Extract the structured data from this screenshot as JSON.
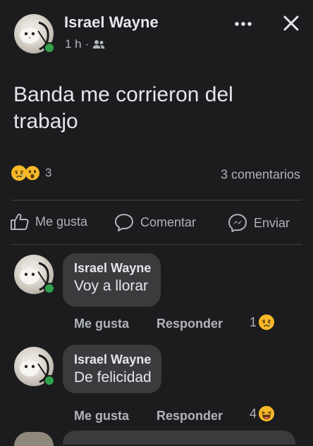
{
  "post": {
    "author": "Israel Wayne",
    "time": "1 h",
    "separator": "·",
    "text": "Banda me corrieron del trabajo",
    "reaction_count": "3",
    "comments_count": "3 comentarios"
  },
  "actions": {
    "like": "Me gusta",
    "comment": "Comentar",
    "send": "Enviar"
  },
  "comments": [
    {
      "author": "Israel Wayne",
      "text": "Voy a llorar",
      "like": "Me gusta",
      "reply": "Responder",
      "reaction_count": "1",
      "reaction_icon": "sad-icon"
    },
    {
      "author": "Israel Wayne",
      "text": "De felicidad",
      "like": "Me gusta",
      "reply": "Responder",
      "reaction_count": "4",
      "reaction_icon": "haha-icon"
    }
  ],
  "colors": {
    "background": "#1c1c1e",
    "bubble": "#3a3b3c",
    "online": "#31a24c",
    "reaction_yellow": "#f7b928",
    "muted_text": "#b0b3b8"
  }
}
